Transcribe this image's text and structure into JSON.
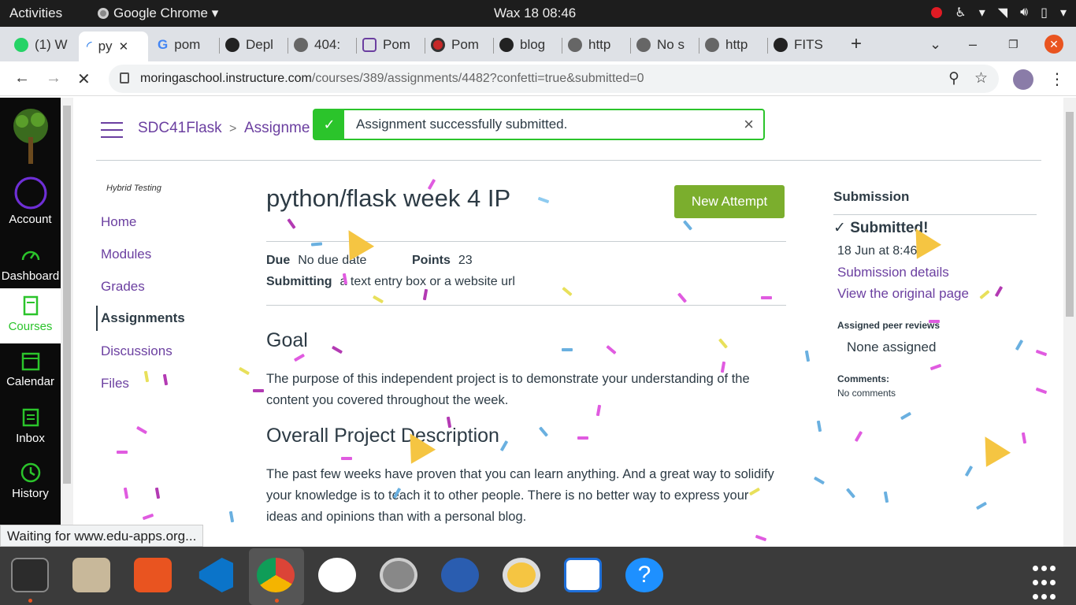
{
  "os": {
    "activities": "Activities",
    "app_name": "Google Chrome",
    "clock": "Wax 18  08:46"
  },
  "browser": {
    "tabs": [
      {
        "label": "(1) W"
      },
      {
        "label": "py"
      },
      {
        "label": "pom"
      },
      {
        "label": "Depl"
      },
      {
        "label": "404:"
      },
      {
        "label": "Pom"
      },
      {
        "label": "Pom"
      },
      {
        "label": "blog"
      },
      {
        "label": "http"
      },
      {
        "label": "No s"
      },
      {
        "label": "http"
      },
      {
        "label": "FITS"
      }
    ],
    "new_tab": "+",
    "url_host": "moringaschool.instructure.com",
    "url_path": "/courses/389/assignments/4482?confetti=true&submitted=0",
    "status_text": "Waiting for www.edu-apps.org..."
  },
  "global_nav": {
    "items": [
      {
        "label": "Account"
      },
      {
        "label": "Dashboard"
      },
      {
        "label": "Courses"
      },
      {
        "label": "Calendar"
      },
      {
        "label": "Inbox"
      },
      {
        "label": "History"
      }
    ]
  },
  "breadcrumb": {
    "course": "SDC41Flask",
    "sep": ">",
    "section": "Assignme"
  },
  "alert": {
    "message": "Assignment successfully submitted.",
    "close": "×"
  },
  "course_nav": {
    "course_name": "Hybrid Testing",
    "items": [
      {
        "label": "Home"
      },
      {
        "label": "Modules"
      },
      {
        "label": "Grades"
      },
      {
        "label": "Assignments"
      },
      {
        "label": "Discussions"
      },
      {
        "label": "Files"
      }
    ]
  },
  "assignment": {
    "title": "python/flask week 4 IP",
    "new_attempt": "New Attempt",
    "due_label": "Due",
    "due_value": "No due date",
    "points_label": "Points",
    "points_value": "23",
    "submitting_label": "Submitting",
    "submitting_value": "a text entry box or a website url",
    "goal_heading": "Goal",
    "goal_text": "The purpose of this independent project is to demonstrate your understanding of the content you covered throughout the week.",
    "overall_heading": "Overall Project Description",
    "overall_text": "The past few weeks have proven that you can learn anything. And a great way to solidify your knowledge is to teach it to other people. There is no better way to express your ideas and opinions than with a personal blog."
  },
  "sidebar": {
    "heading": "Submission",
    "status": "Submitted!",
    "date": "18 Jun at 8:46",
    "details_link": "Submission details",
    "original_link": "View the original page",
    "peer_heading": "Assigned peer reviews",
    "peer_value": "None assigned",
    "comments_heading": "Comments:",
    "comments_value": "No comments"
  },
  "colors": {
    "canvas_purple": "#6b3fa0",
    "success_green": "#2bc42b",
    "button_green": "#7bae2d",
    "nav_black": "#0b0b0b"
  }
}
